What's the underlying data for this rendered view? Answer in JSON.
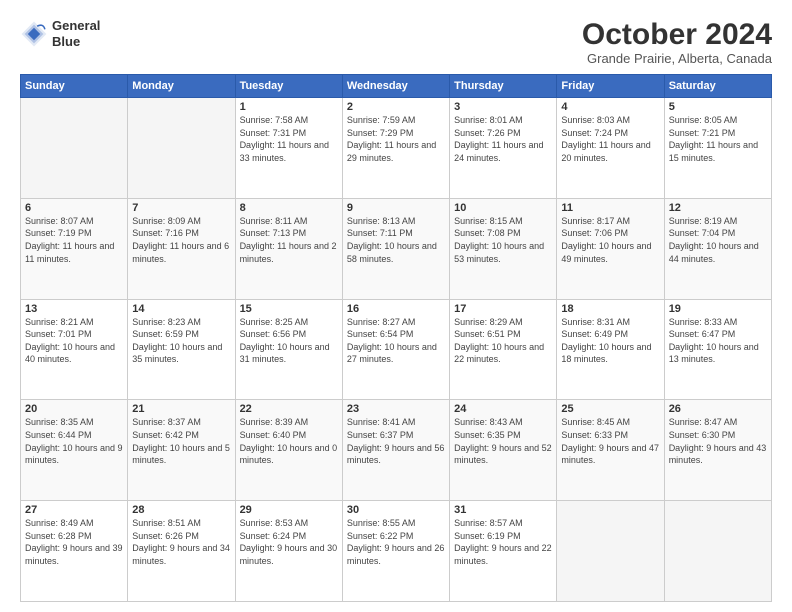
{
  "logo": {
    "line1": "General",
    "line2": "Blue"
  },
  "title": "October 2024",
  "subtitle": "Grande Prairie, Alberta, Canada",
  "days_header": [
    "Sunday",
    "Monday",
    "Tuesday",
    "Wednesday",
    "Thursday",
    "Friday",
    "Saturday"
  ],
  "weeks": [
    [
      {
        "day": "",
        "sunrise": "",
        "sunset": "",
        "daylight": ""
      },
      {
        "day": "",
        "sunrise": "",
        "sunset": "",
        "daylight": ""
      },
      {
        "day": "1",
        "sunrise": "Sunrise: 7:58 AM",
        "sunset": "Sunset: 7:31 PM",
        "daylight": "Daylight: 11 hours and 33 minutes."
      },
      {
        "day": "2",
        "sunrise": "Sunrise: 7:59 AM",
        "sunset": "Sunset: 7:29 PM",
        "daylight": "Daylight: 11 hours and 29 minutes."
      },
      {
        "day": "3",
        "sunrise": "Sunrise: 8:01 AM",
        "sunset": "Sunset: 7:26 PM",
        "daylight": "Daylight: 11 hours and 24 minutes."
      },
      {
        "day": "4",
        "sunrise": "Sunrise: 8:03 AM",
        "sunset": "Sunset: 7:24 PM",
        "daylight": "Daylight: 11 hours and 20 minutes."
      },
      {
        "day": "5",
        "sunrise": "Sunrise: 8:05 AM",
        "sunset": "Sunset: 7:21 PM",
        "daylight": "Daylight: 11 hours and 15 minutes."
      }
    ],
    [
      {
        "day": "6",
        "sunrise": "Sunrise: 8:07 AM",
        "sunset": "Sunset: 7:19 PM",
        "daylight": "Daylight: 11 hours and 11 minutes."
      },
      {
        "day": "7",
        "sunrise": "Sunrise: 8:09 AM",
        "sunset": "Sunset: 7:16 PM",
        "daylight": "Daylight: 11 hours and 6 minutes."
      },
      {
        "day": "8",
        "sunrise": "Sunrise: 8:11 AM",
        "sunset": "Sunset: 7:13 PM",
        "daylight": "Daylight: 11 hours and 2 minutes."
      },
      {
        "day": "9",
        "sunrise": "Sunrise: 8:13 AM",
        "sunset": "Sunset: 7:11 PM",
        "daylight": "Daylight: 10 hours and 58 minutes."
      },
      {
        "day": "10",
        "sunrise": "Sunrise: 8:15 AM",
        "sunset": "Sunset: 7:08 PM",
        "daylight": "Daylight: 10 hours and 53 minutes."
      },
      {
        "day": "11",
        "sunrise": "Sunrise: 8:17 AM",
        "sunset": "Sunset: 7:06 PM",
        "daylight": "Daylight: 10 hours and 49 minutes."
      },
      {
        "day": "12",
        "sunrise": "Sunrise: 8:19 AM",
        "sunset": "Sunset: 7:04 PM",
        "daylight": "Daylight: 10 hours and 44 minutes."
      }
    ],
    [
      {
        "day": "13",
        "sunrise": "Sunrise: 8:21 AM",
        "sunset": "Sunset: 7:01 PM",
        "daylight": "Daylight: 10 hours and 40 minutes."
      },
      {
        "day": "14",
        "sunrise": "Sunrise: 8:23 AM",
        "sunset": "Sunset: 6:59 PM",
        "daylight": "Daylight: 10 hours and 35 minutes."
      },
      {
        "day": "15",
        "sunrise": "Sunrise: 8:25 AM",
        "sunset": "Sunset: 6:56 PM",
        "daylight": "Daylight: 10 hours and 31 minutes."
      },
      {
        "day": "16",
        "sunrise": "Sunrise: 8:27 AM",
        "sunset": "Sunset: 6:54 PM",
        "daylight": "Daylight: 10 hours and 27 minutes."
      },
      {
        "day": "17",
        "sunrise": "Sunrise: 8:29 AM",
        "sunset": "Sunset: 6:51 PM",
        "daylight": "Daylight: 10 hours and 22 minutes."
      },
      {
        "day": "18",
        "sunrise": "Sunrise: 8:31 AM",
        "sunset": "Sunset: 6:49 PM",
        "daylight": "Daylight: 10 hours and 18 minutes."
      },
      {
        "day": "19",
        "sunrise": "Sunrise: 8:33 AM",
        "sunset": "Sunset: 6:47 PM",
        "daylight": "Daylight: 10 hours and 13 minutes."
      }
    ],
    [
      {
        "day": "20",
        "sunrise": "Sunrise: 8:35 AM",
        "sunset": "Sunset: 6:44 PM",
        "daylight": "Daylight: 10 hours and 9 minutes."
      },
      {
        "day": "21",
        "sunrise": "Sunrise: 8:37 AM",
        "sunset": "Sunset: 6:42 PM",
        "daylight": "Daylight: 10 hours and 5 minutes."
      },
      {
        "day": "22",
        "sunrise": "Sunrise: 8:39 AM",
        "sunset": "Sunset: 6:40 PM",
        "daylight": "Daylight: 10 hours and 0 minutes."
      },
      {
        "day": "23",
        "sunrise": "Sunrise: 8:41 AM",
        "sunset": "Sunset: 6:37 PM",
        "daylight": "Daylight: 9 hours and 56 minutes."
      },
      {
        "day": "24",
        "sunrise": "Sunrise: 8:43 AM",
        "sunset": "Sunset: 6:35 PM",
        "daylight": "Daylight: 9 hours and 52 minutes."
      },
      {
        "day": "25",
        "sunrise": "Sunrise: 8:45 AM",
        "sunset": "Sunset: 6:33 PM",
        "daylight": "Daylight: 9 hours and 47 minutes."
      },
      {
        "day": "26",
        "sunrise": "Sunrise: 8:47 AM",
        "sunset": "Sunset: 6:30 PM",
        "daylight": "Daylight: 9 hours and 43 minutes."
      }
    ],
    [
      {
        "day": "27",
        "sunrise": "Sunrise: 8:49 AM",
        "sunset": "Sunset: 6:28 PM",
        "daylight": "Daylight: 9 hours and 39 minutes."
      },
      {
        "day": "28",
        "sunrise": "Sunrise: 8:51 AM",
        "sunset": "Sunset: 6:26 PM",
        "daylight": "Daylight: 9 hours and 34 minutes."
      },
      {
        "day": "29",
        "sunrise": "Sunrise: 8:53 AM",
        "sunset": "Sunset: 6:24 PM",
        "daylight": "Daylight: 9 hours and 30 minutes."
      },
      {
        "day": "30",
        "sunrise": "Sunrise: 8:55 AM",
        "sunset": "Sunset: 6:22 PM",
        "daylight": "Daylight: 9 hours and 26 minutes."
      },
      {
        "day": "31",
        "sunrise": "Sunrise: 8:57 AM",
        "sunset": "Sunset: 6:19 PM",
        "daylight": "Daylight: 9 hours and 22 minutes."
      },
      {
        "day": "",
        "sunrise": "",
        "sunset": "",
        "daylight": ""
      },
      {
        "day": "",
        "sunrise": "",
        "sunset": "",
        "daylight": ""
      }
    ]
  ]
}
